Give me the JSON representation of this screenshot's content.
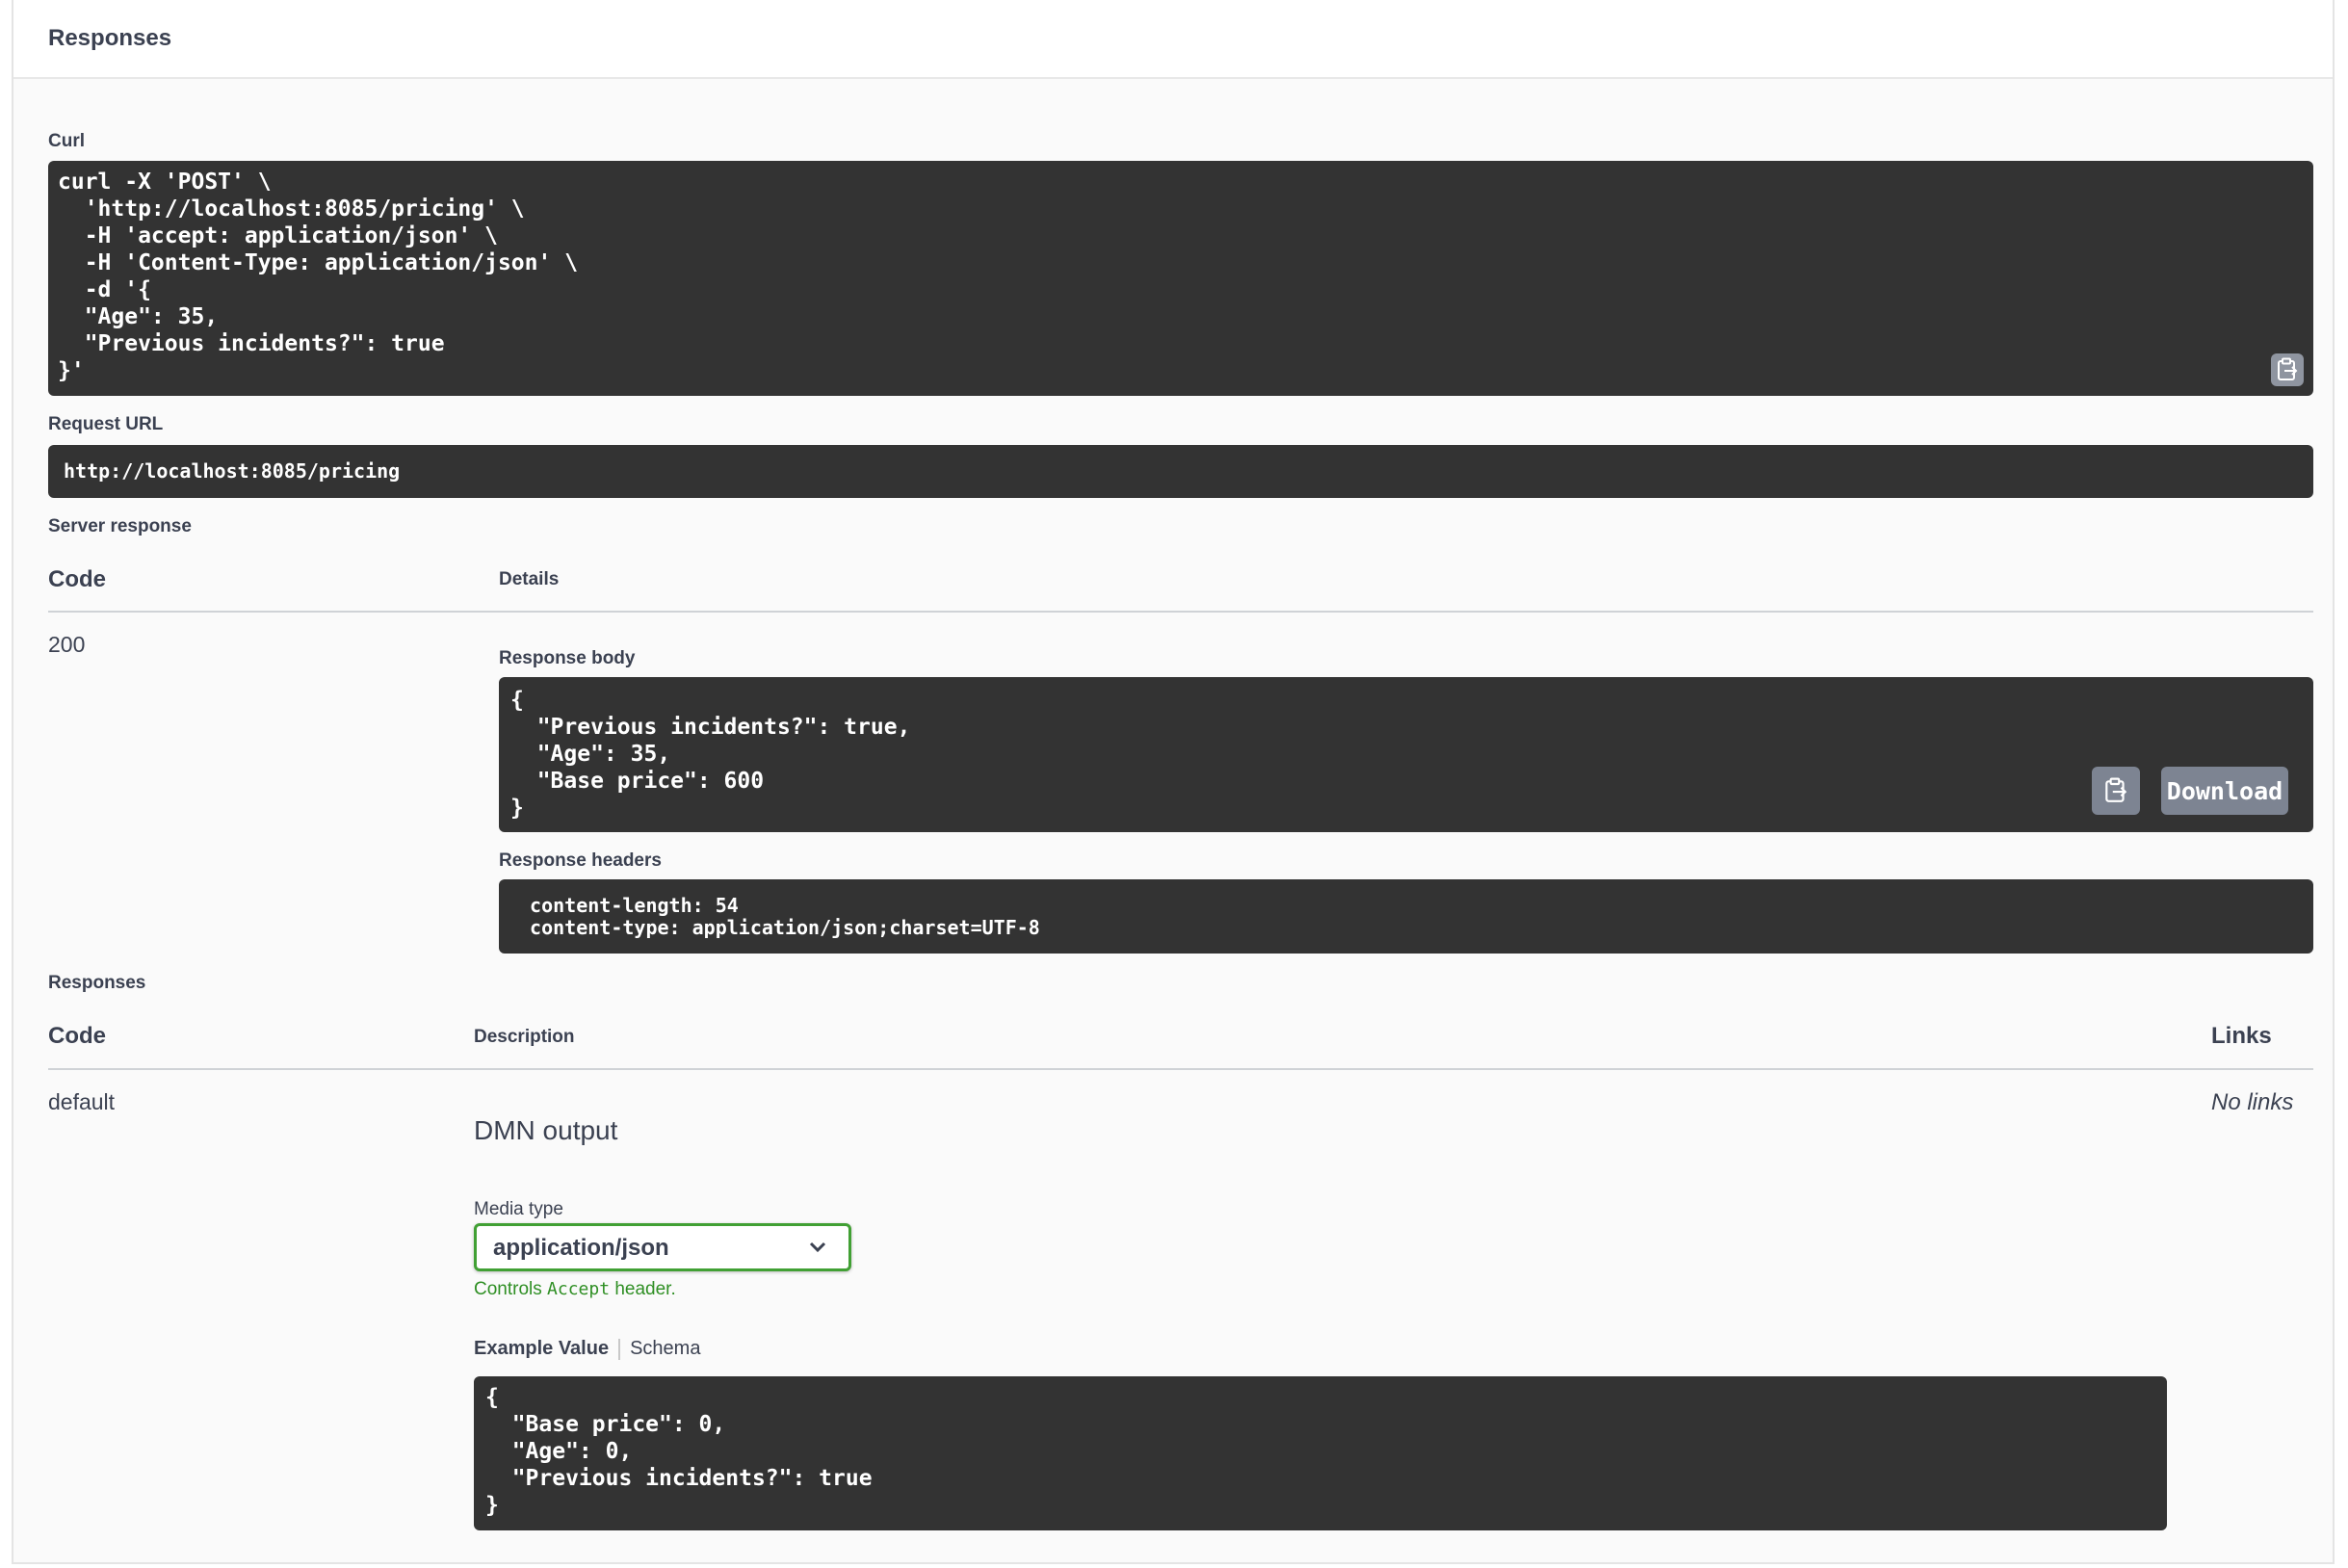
{
  "panel": {
    "title": "Responses"
  },
  "curl": {
    "label": "Curl",
    "command": "curl -X 'POST' \\\n  'http://localhost:8085/pricing' \\\n  -H 'accept: application/json' \\\n  -H 'Content-Type: application/json' \\\n  -d '{\n  \"Age\": 35,\n  \"Previous incidents?\": true\n}'"
  },
  "request_url": {
    "label": "Request URL",
    "value": "http://localhost:8085/pricing"
  },
  "server_response": {
    "label": "Server response",
    "col_code": "Code",
    "col_details": "Details",
    "code": "200",
    "body_label": "Response body",
    "body": "{\n  \"Previous incidents?\": true,\n  \"Age\": 35,\n  \"Base price\": 600\n}",
    "download_label": "Download",
    "headers_label": "Response headers",
    "headers": " content-length: 54 \n content-type: application/json;charset=UTF-8 "
  },
  "responses": {
    "label": "Responses",
    "col_code": "Code",
    "col_description": "Description",
    "col_links": "Links",
    "row": {
      "code": "default",
      "description": "DMN output",
      "links": "No links",
      "media_type_label": "Media type",
      "media_type_value": "application/json",
      "controls_prefix": "Controls ",
      "controls_code": "Accept",
      "controls_suffix": " header.",
      "tab_example": "Example Value",
      "tab_schema": "Schema",
      "example": "{\n  \"Base price\": 0,\n  \"Age\": 0,\n  \"Previous incidents?\": true\n}"
    }
  },
  "colors": {
    "code_bg": "#333333",
    "accent_green": "#41a034",
    "button_gray": "#7d8492"
  },
  "icons": {
    "copy": "clipboard-copy-icon",
    "dropdown": "chevron-down-icon"
  }
}
